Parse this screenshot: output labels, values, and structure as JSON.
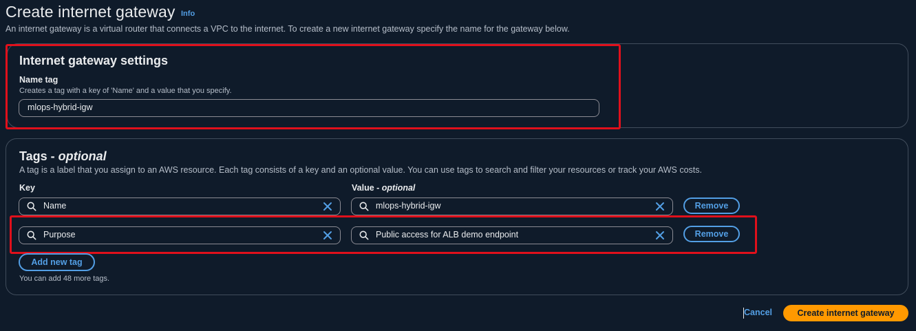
{
  "header": {
    "title": "Create internet gateway",
    "info_link": "Info",
    "description": "An internet gateway is a virtual router that connects a VPC to the internet. To create a new internet gateway specify the name for the gateway below."
  },
  "settings": {
    "title": "Internet gateway settings",
    "name_tag_label": "Name tag",
    "name_tag_hint": "Creates a tag with a key of 'Name' and a value that you specify.",
    "name_tag_value": "mlops-hybrid-igw"
  },
  "tags": {
    "title_main": "Tags - ",
    "title_optional": "optional",
    "description": "A tag is a label that you assign to an AWS resource. Each tag consists of a key and an optional value. You can use tags to search and filter your resources or track your AWS costs.",
    "key_label": "Key",
    "value_label_main": "Value - ",
    "value_label_optional": "optional",
    "rows": [
      {
        "key": "Name",
        "value": "mlops-hybrid-igw",
        "remove_label": "Remove"
      },
      {
        "key": "Purpose",
        "value": "Public access for ALB demo endpoint",
        "remove_label": "Remove"
      }
    ],
    "add_label": "Add new tag",
    "limit_text": "You can add 48 more tags."
  },
  "footer": {
    "cancel_label": "Cancel",
    "create_label": "Create internet gateway"
  },
  "icons": {
    "search": "search-icon",
    "clear": "clear-icon"
  },
  "colors": {
    "background": "#0f1b2a",
    "accent_link": "#539fe5",
    "primary_button": "#ff9900",
    "highlight_red": "#e0101b",
    "panel_border": "#414d5c"
  }
}
